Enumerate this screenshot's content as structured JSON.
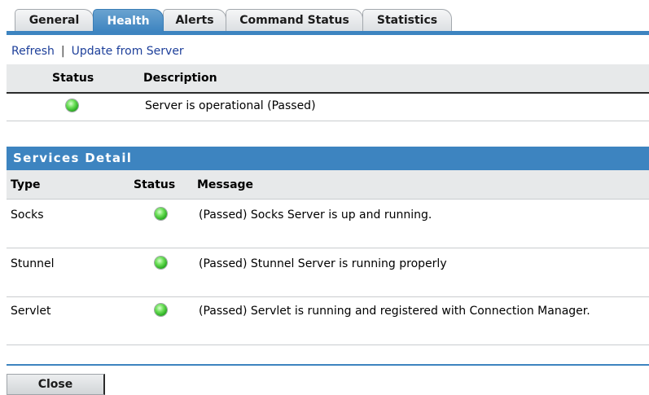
{
  "tabs": [
    {
      "label": "General",
      "active": false
    },
    {
      "label": "Health",
      "active": true
    },
    {
      "label": "Alerts",
      "active": false
    },
    {
      "label": "Command Status",
      "active": false
    },
    {
      "label": "Statistics",
      "active": false
    }
  ],
  "links": {
    "refresh": "Refresh",
    "separator": "|",
    "update": "Update from Server"
  },
  "health": {
    "headers": {
      "status": "Status",
      "description": "Description"
    },
    "rows": [
      {
        "status": "green-status-icon",
        "description": "Server is operational (Passed)"
      }
    ]
  },
  "services": {
    "title": "Services Detail",
    "headers": {
      "type": "Type",
      "status": "Status",
      "message": "Message"
    },
    "rows": [
      {
        "type": "Socks",
        "status": "green-status-icon",
        "message": "(Passed) Socks Server is up and running."
      },
      {
        "type": "Stunnel",
        "status": "green-status-icon",
        "message": "(Passed) Stunnel Server is running properly"
      },
      {
        "type": "Servlet",
        "status": "green-status-icon",
        "message": "(Passed) Servlet is running and registered with Connection Manager."
      }
    ]
  },
  "footer": {
    "close_label": "Close"
  },
  "colors": {
    "accent": "#3d84c0",
    "link": "#1d3f9a",
    "status_ok": "#21a51a"
  }
}
